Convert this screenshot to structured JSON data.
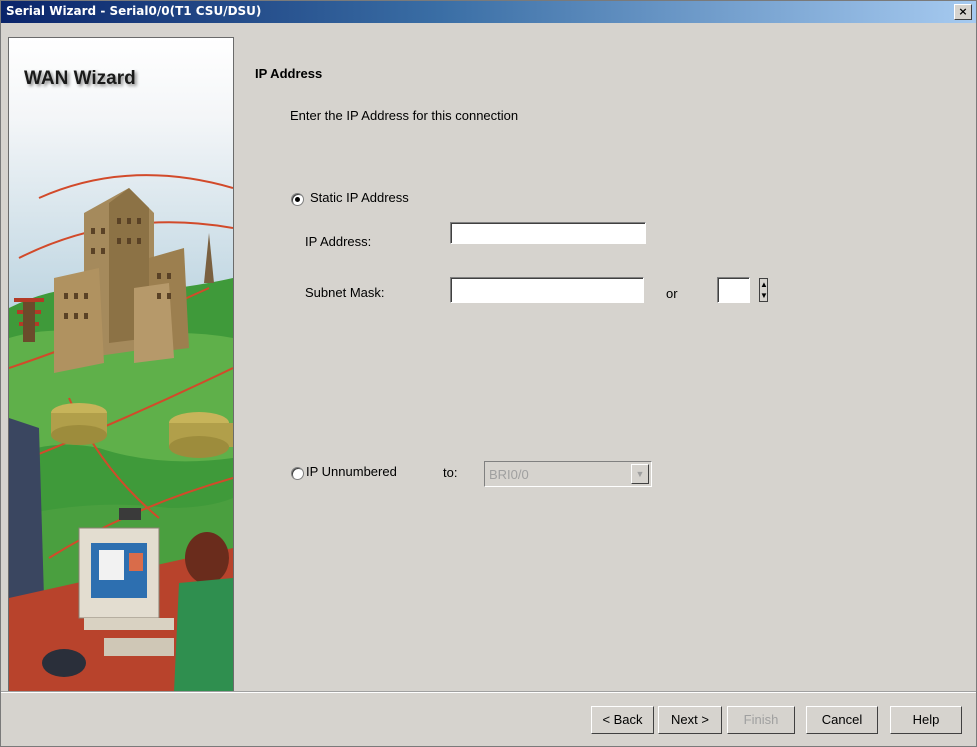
{
  "window": {
    "title": "Serial Wizard - Serial0/0(T1 CSU/DSU)",
    "close_label": "×"
  },
  "side_panel": {
    "title": "WAN Wizard"
  },
  "page": {
    "section_title": "IP Address",
    "description": "Enter the IP Address for this connection"
  },
  "static_ip": {
    "label": "Static IP Address",
    "selected": true,
    "ip_address_label": "IP Address:",
    "ip_address_value": "",
    "subnet_mask_label": "Subnet Mask:",
    "subnet_mask_value": "",
    "or_label": "or",
    "prefix_value": ""
  },
  "ip_unnumbered": {
    "label": "IP Unnumbered",
    "selected": false,
    "to_label": "to:",
    "interface_value": "BRI0/0",
    "enabled": false
  },
  "buttons": {
    "back": "< Back",
    "next": "Next >",
    "finish": "Finish",
    "cancel": "Cancel",
    "help": "Help"
  },
  "colors": {
    "titlebar_start": "#0a246a",
    "titlebar_end": "#a6caf0",
    "dialog_bg": "#d6d3ce",
    "disabled_text": "#a0a0a0"
  }
}
